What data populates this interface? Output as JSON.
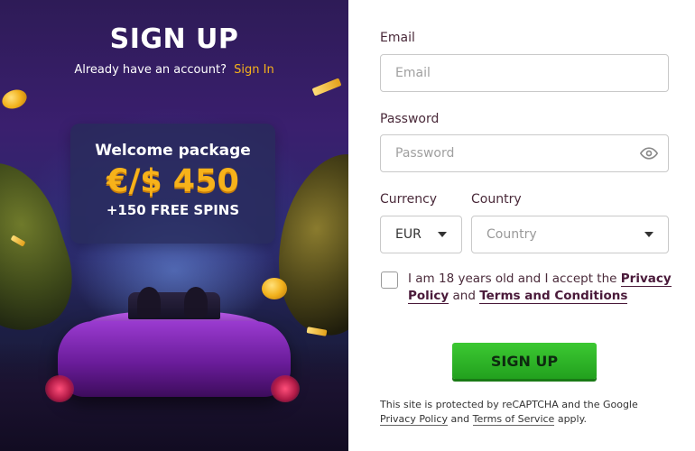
{
  "promo": {
    "title": "SIGN UP",
    "have_account": "Already have an account?",
    "sign_in_link": "Sign In",
    "welcome": {
      "label": "Welcome package",
      "amount": "€/$ 450",
      "spins": "+150 FREE SPINS"
    },
    "colors": {
      "accent": "#f7b21a",
      "panel_bg": "#2e1b57"
    }
  },
  "form": {
    "email": {
      "label": "Email",
      "placeholder": "Email"
    },
    "password": {
      "label": "Password",
      "placeholder": "Password",
      "toggle_icon": "eye-icon"
    },
    "currency": {
      "label": "Currency",
      "value": "EUR"
    },
    "country": {
      "label": "Country",
      "value": "Country"
    },
    "accept": {
      "prefix": "I am 18 years old and I accept the",
      "privacy_link": "Privacy Policy",
      "and": "and",
      "terms_link": "Terms and Conditions",
      "checked": false
    },
    "submit_label": "SIGN UP",
    "recaptcha": {
      "text": "This site is protected by reCAPTCHA and the Google",
      "privacy_link": "Privacy Policy",
      "and": "and",
      "terms_link": "Terms of Service",
      "suffix": "apply."
    },
    "colors": {
      "button": "#2eb52a",
      "label_text": "#4a2a3a"
    }
  }
}
